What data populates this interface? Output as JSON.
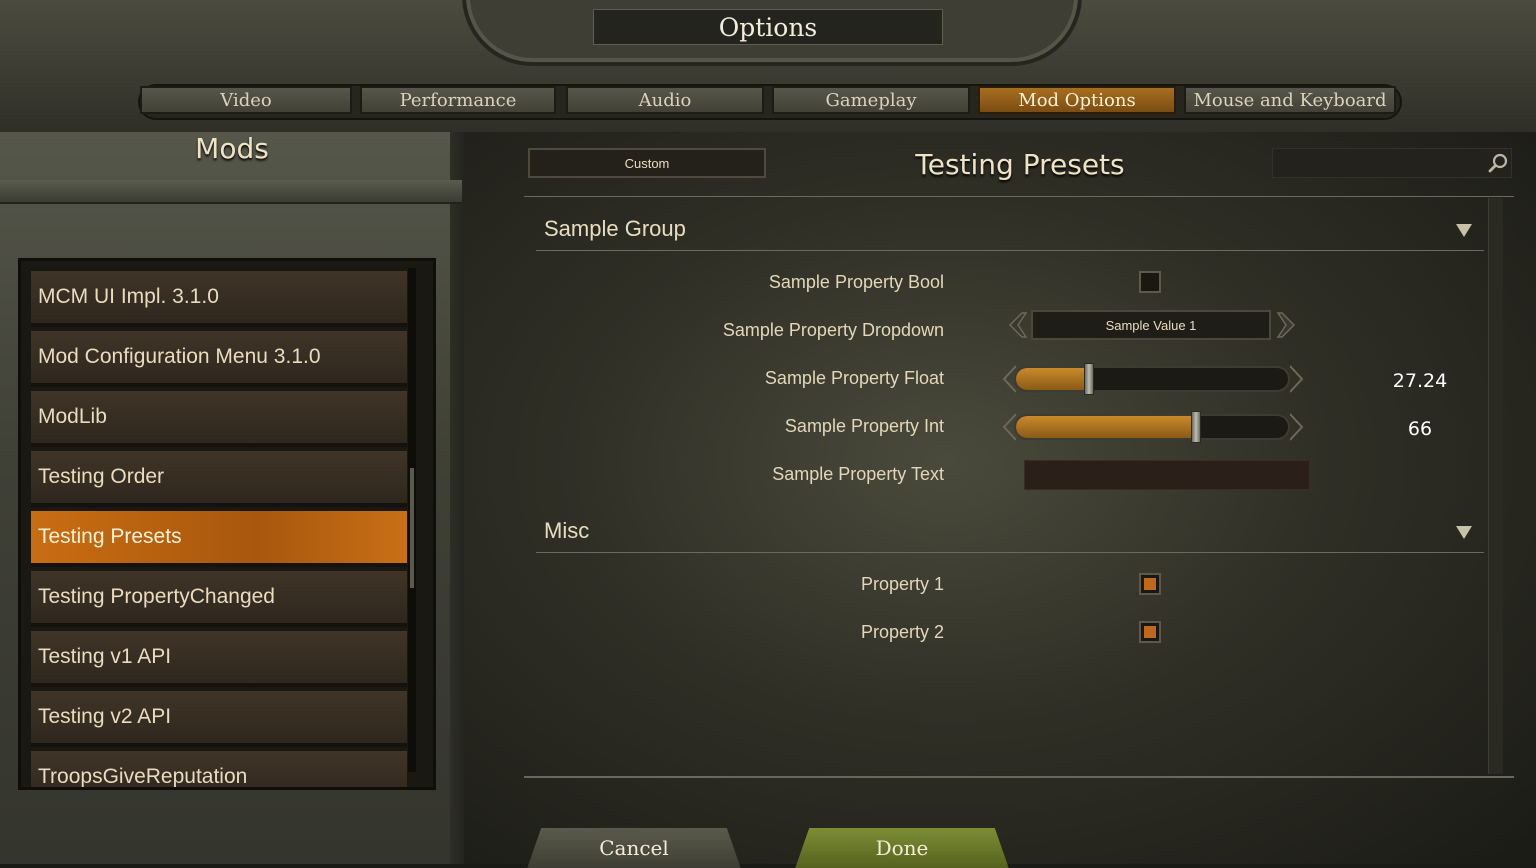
{
  "window": {
    "title": "Options"
  },
  "tabs": [
    {
      "label": "Video"
    },
    {
      "label": "Performance"
    },
    {
      "label": "Audio"
    },
    {
      "label": "Gameplay"
    },
    {
      "label": "Mod Options",
      "active": true
    },
    {
      "label": "Mouse and Keyboard"
    }
  ],
  "sidebar": {
    "title": "Mods",
    "items": [
      {
        "label": "MCM UI Impl. 3.1.0"
      },
      {
        "label": "Mod Configuration Menu 3.1.0"
      },
      {
        "label": "ModLib"
      },
      {
        "label": "Testing Order"
      },
      {
        "label": "Testing Presets",
        "active": true
      },
      {
        "label": "Testing PropertyChanged"
      },
      {
        "label": "Testing v1 API"
      },
      {
        "label": "Testing v2 API"
      },
      {
        "label": "TroopsGiveReputation"
      }
    ]
  },
  "main": {
    "preset": "Custom",
    "title": "Testing Presets",
    "search": {
      "value": "",
      "icon": "search-icon"
    },
    "groups": [
      {
        "name": "Sample Group",
        "properties": {
          "bool": {
            "label": "Sample Property Bool",
            "checked": false
          },
          "dropdown": {
            "label": "Sample Property Dropdown",
            "value": "Sample Value 1"
          },
          "float": {
            "label": "Sample Property Float",
            "value": "27.24",
            "fraction": 0.27
          },
          "int": {
            "label": "Sample Property Int",
            "value": "66",
            "fraction": 0.66
          },
          "text": {
            "label": "Sample Property Text",
            "value": ""
          }
        }
      },
      {
        "name": "Misc",
        "properties": {
          "p1": {
            "label": "Property 1",
            "checked": true
          },
          "p2": {
            "label": "Property 2",
            "checked": true
          }
        }
      }
    ]
  },
  "footer": {
    "cancel_label": "Cancel",
    "done_label": "Done"
  },
  "colors": {
    "accent": "#c0691a",
    "active_tab": "#a86e20",
    "done_button": "#6b7a2a"
  }
}
